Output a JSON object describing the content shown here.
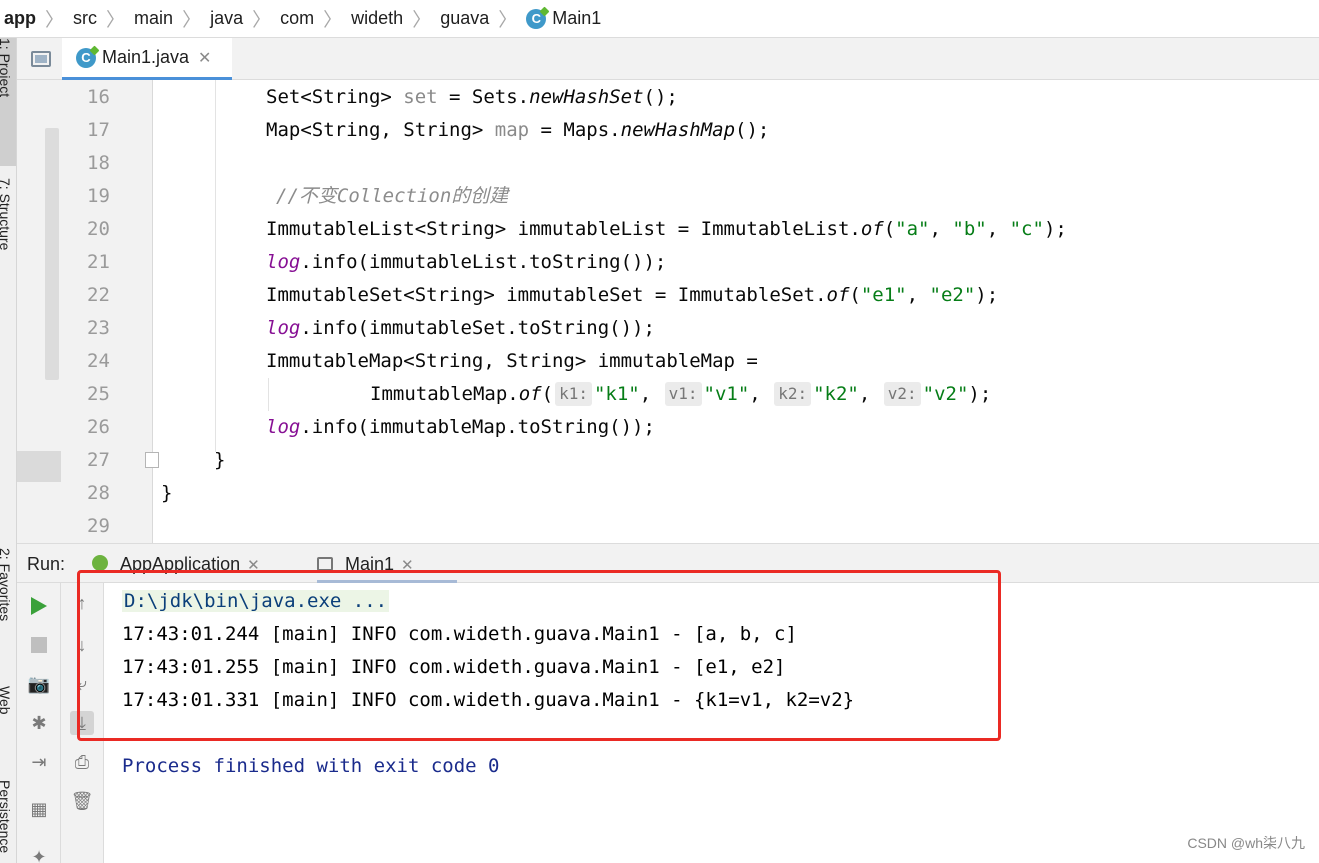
{
  "breadcrumb": [
    "app",
    "src",
    "main",
    "java",
    "com",
    "wideth",
    "guava",
    "Main1"
  ],
  "left_strip": [
    "1: Project",
    "7: Structure",
    "2: Favorites",
    "Web",
    "Persistence"
  ],
  "editor": {
    "tab_label": "Main1.java",
    "line_numbers": [
      "16",
      "17",
      "18",
      "19",
      "20",
      "21",
      "22",
      "23",
      "24",
      "25",
      "26",
      "27",
      "28",
      "29"
    ],
    "code": {
      "l16_a": "Set<String> ",
      "l16_var": "set",
      "l16_b": " = Sets.",
      "l16_m": "newHashSet",
      "l16_c": "();",
      "l17_a": "Map<String, String> ",
      "l17_var": "map",
      "l17_b": " = Maps.",
      "l17_m": "newHashMap",
      "l17_c": "();",
      "l19_comment": "//不变Collection的创建",
      "l20_a": "ImmutableList<String> immutableList = ImmutableList.",
      "l20_m": "of",
      "l20_b": "(",
      "l20_s1": "\"a\"",
      "l20_s2": "\"b\"",
      "l20_s3": "\"c\"",
      "l20_c": ");",
      "log": "log",
      "l21_b": ".info(immutableList.toString());",
      "l22_a": "ImmutableSet<String> immutableSet = ImmutableSet.",
      "l22_m": "of",
      "l22_b": "(",
      "l22_s1": "\"e1\"",
      "l22_s2": "\"e2\"",
      "l22_c": ");",
      "l23_b": ".info(immutableSet.toString());",
      "l24": "ImmutableMap<String, String> immutableMap =",
      "l25_a": "ImmutableMap.",
      "l25_m": "of",
      "l25_b": "(",
      "hint_k1": "k1:",
      "s_k1": "\"k1\"",
      "hint_v1": "v1:",
      "s_v1": "\"v1\"",
      "hint_k2": "k2:",
      "s_k2": "\"k2\"",
      "hint_v2": "v2:",
      "s_v2": "\"v2\"",
      "l25_c": ");",
      "l26_b": ".info(immutableMap.toString());",
      "l27": "}",
      "l28": "}"
    }
  },
  "run": {
    "label": "Run:",
    "tabs": [
      "AppApplication",
      "Main1"
    ],
    "console": [
      "D:\\jdk\\bin\\java.exe ...",
      "17:43:01.244 [main] INFO com.wideth.guava.Main1 - [a, b, c]",
      "17:43:01.255 [main] INFO com.wideth.guava.Main1 - [e1, e2]",
      "17:43:01.331 [main] INFO com.wideth.guava.Main1 - {k1=v1, k2=v2}",
      "Process finished with exit code 0"
    ]
  },
  "watermark": "CSDN @wh柒八九",
  "colors": {
    "highlight_box": "#ea2a24",
    "string": "#067d17",
    "field": "#871094",
    "tab_accent": "#4a90d9"
  }
}
